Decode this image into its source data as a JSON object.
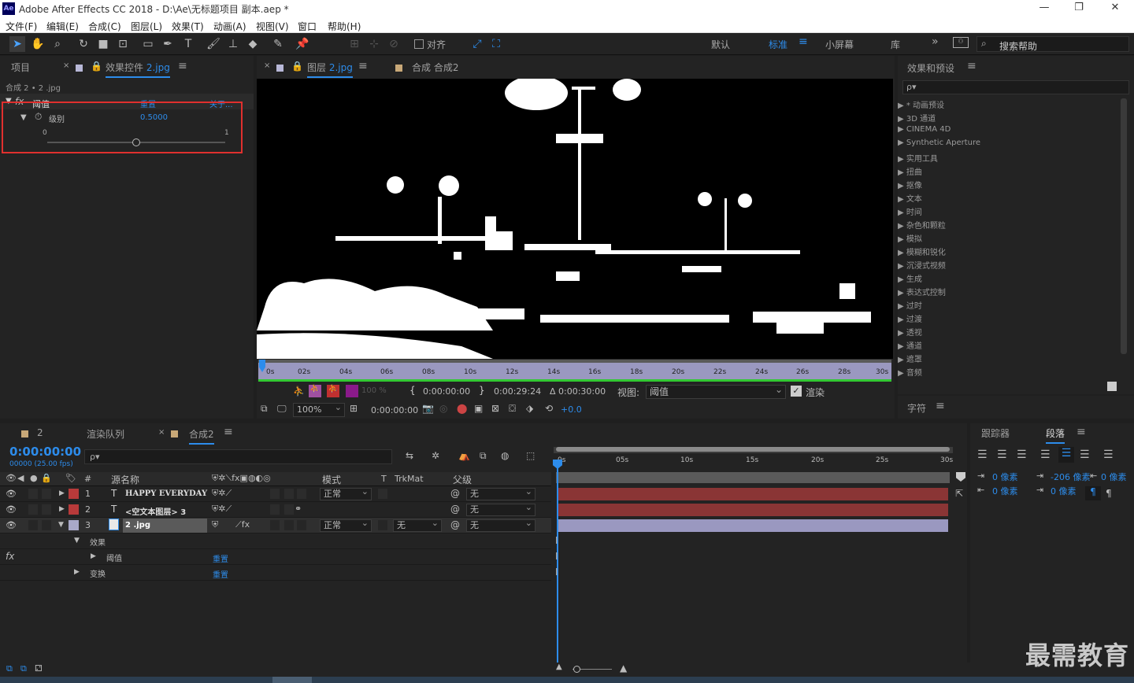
{
  "window": {
    "title": "Adobe After Effects CC 2018 - D:\\Ae\\无标题项目 副本.aep *",
    "logo": "Ae"
  },
  "menu": [
    "文件(F)",
    "编辑(E)",
    "合成(C)",
    "图层(L)",
    "效果(T)",
    "动画(A)",
    "视图(V)",
    "窗口",
    "帮助(H)"
  ],
  "toolbar": {
    "snap_label": "对齐",
    "workspaces": [
      "默认",
      "标准",
      "小屏幕",
      "库"
    ],
    "active_workspace": "标准",
    "search_placeholder": "搜索帮助"
  },
  "left_panel": {
    "tab_project": "项目",
    "tab_effect_controls": "效果控件",
    "effect_target": "2.jpg",
    "breadcrumb": "合成 2 • 2 .jpg",
    "effect": {
      "fx": "fx",
      "name": "阈值",
      "reset": "重置",
      "about": "关于...",
      "param_name": "级别",
      "param_value": "0.5000",
      "slider_min": "0",
      "slider_max": "1",
      "slider_fraction": 0.5
    }
  },
  "viewer": {
    "tab_layer": "图层",
    "layer_name": "2.jpg",
    "tab_comp": "合成 合成2",
    "ruler_labels": [
      "0s",
      "02s",
      "04s",
      "06s",
      "08s",
      "10s",
      "12s",
      "14s",
      "16s",
      "18s",
      "20s",
      "22s",
      "24s",
      "26s",
      "28s",
      "30s"
    ],
    "opacity": "100 %",
    "in_time": "0:00:00:00",
    "out_time": "0:00:29:24",
    "duration": "Δ 0:00:30:00",
    "view_label": "视图:",
    "view_value": "阈值",
    "render_label": "渲染",
    "zoom": "100%",
    "current_time": "0:00:00:00",
    "exposure": "+0.0"
  },
  "effects_presets": {
    "title": "效果和预设",
    "search_placeholder": "ρ▾",
    "items": [
      "* 动画预设",
      "3D 通道",
      "CINEMA 4D",
      "Synthetic Aperture",
      "实用工具",
      "扭曲",
      "抠像",
      "文本",
      "时间",
      "杂色和颗粒",
      "模拟",
      "模糊和锐化",
      "沉浸式视频",
      "生成",
      "表达式控制",
      "过时",
      "过渡",
      "透视",
      "通道",
      "遮罩",
      "音频"
    ]
  },
  "character_panel": {
    "title": "字符"
  },
  "timeline": {
    "tab_2": "2",
    "tab_render": "渲染队列",
    "tab_comp": "合成2",
    "timecode": "0:00:00:00",
    "fps": "00000 (25.00 fps)",
    "search_placeholder": "ρ▾",
    "col_hash": "#",
    "col_source": "源名称",
    "col_mode": "模式",
    "col_t": "T",
    "col_trkmat": "TrkMat",
    "col_parent": "父级",
    "ruler_labels": [
      "0s",
      "05s",
      "10s",
      "15s",
      "20s",
      "25s",
      "30s"
    ],
    "layers": [
      {
        "num": "1",
        "type": "T",
        "name": "HAPPY EVERYDAY",
        "color": "#b83a3a",
        "mode": "正常",
        "trkmat": "",
        "parent": "无"
      },
      {
        "num": "2",
        "type": "T",
        "name": "<空文本图层> 3",
        "color": "#b83a3a",
        "mode": "",
        "trkmat": "",
        "parent": "无"
      },
      {
        "num": "3",
        "type": "img",
        "name": "2 .jpg",
        "color": "#a8a8c8",
        "mode": "正常",
        "trkmat": "无",
        "parent": "无"
      }
    ],
    "sub_effects": "效果",
    "sub_threshold": "阈值",
    "sub_transform": "变换",
    "reset": "重置"
  },
  "right_bottom": {
    "tab_tracker": "跟踪器",
    "tab_paragraph": "段落",
    "indent_left": "0 像素",
    "indent_right": "0 像素",
    "indent_first": "-206 像素",
    "space_before": "0 像素",
    "space_after": "0 像素",
    "extra_value": "0 像素"
  },
  "watermark": "最需教育",
  "colors": {
    "accent": "#2d8ceb",
    "highlight_red": "#e0302e",
    "track_red": "#8a3535",
    "track_purple": "#9a98c0",
    "panel_bg": "#232323"
  }
}
